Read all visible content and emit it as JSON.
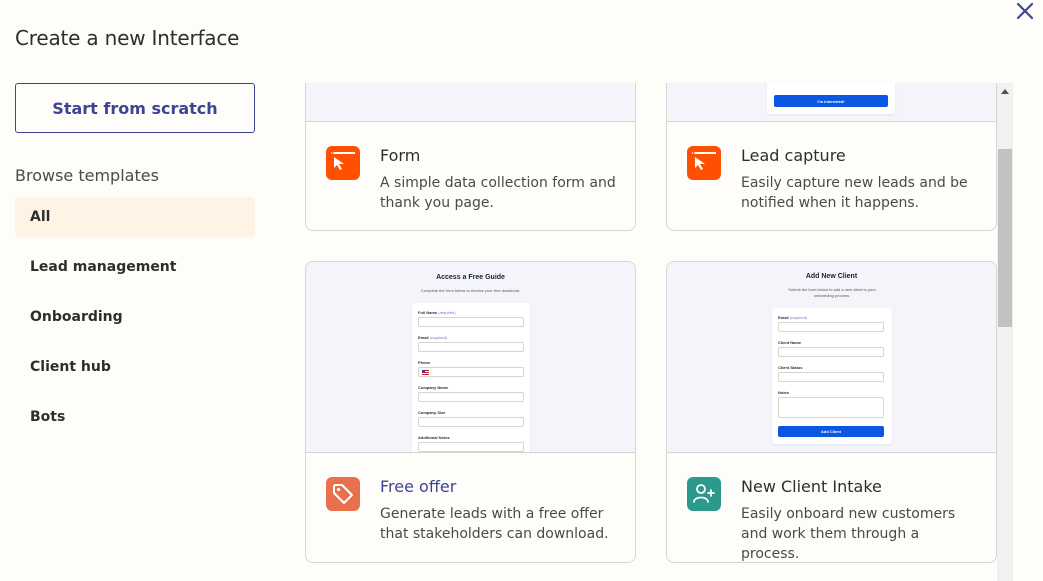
{
  "header": {
    "title": "Create a new Interface"
  },
  "start_button": "Start from scratch",
  "browse": {
    "heading": "Browse templates",
    "items": [
      {
        "label": "All"
      },
      {
        "label": "Lead management"
      },
      {
        "label": "Onboarding"
      },
      {
        "label": "Client hub"
      },
      {
        "label": "Bots"
      }
    ]
  },
  "cards": [
    {
      "title": "Form",
      "description": "A simple data collection form and thank you page.",
      "icon": "cursor-window-icon",
      "icon_color": "#ff4f00"
    },
    {
      "title": "Lead capture",
      "description": "Easily capture new leads and be notified when it happens.",
      "icon": "cursor-window-icon",
      "icon_color": "#ff4f00",
      "preview": {
        "button": "I'm interested!"
      }
    },
    {
      "title": "Free offer",
      "description": "Generate leads with a free offer that stakeholders can download.",
      "icon": "tag-icon",
      "icon_color": "#e8704f",
      "preview": {
        "heading": "Access a Free Guide",
        "subheading": "Complete the form below to receive your free download.",
        "fields": [
          {
            "label": "Full Name",
            "hint": "(required)"
          },
          {
            "label": "Email",
            "hint": "(required)"
          },
          {
            "label": "Phone",
            "hint": ""
          },
          {
            "label": "Company Name",
            "hint": ""
          },
          {
            "label": "Company Size",
            "hint": ""
          },
          {
            "label": "Additional Notes",
            "hint": ""
          }
        ]
      }
    },
    {
      "title": "New Client Intake",
      "description": "Easily onboard new customers and work them through a process.",
      "icon": "add-user-icon",
      "icon_color": "#2b9a8a",
      "preview": {
        "heading": "Add New Client",
        "subheading": "Submit the form below to add a new client to your onboarding process.",
        "fields": [
          {
            "label": "Email",
            "hint": "(required)"
          },
          {
            "label": "Client Name",
            "hint": ""
          },
          {
            "label": "Client Status",
            "hint": ""
          },
          {
            "label": "Notes",
            "hint": ""
          }
        ],
        "button": "Add Client"
      }
    }
  ],
  "colors": {
    "accent": "#3d4592",
    "orange": "#ff4f00",
    "active_bg": "#fff3e6",
    "primary_button": "#0b57e3"
  }
}
